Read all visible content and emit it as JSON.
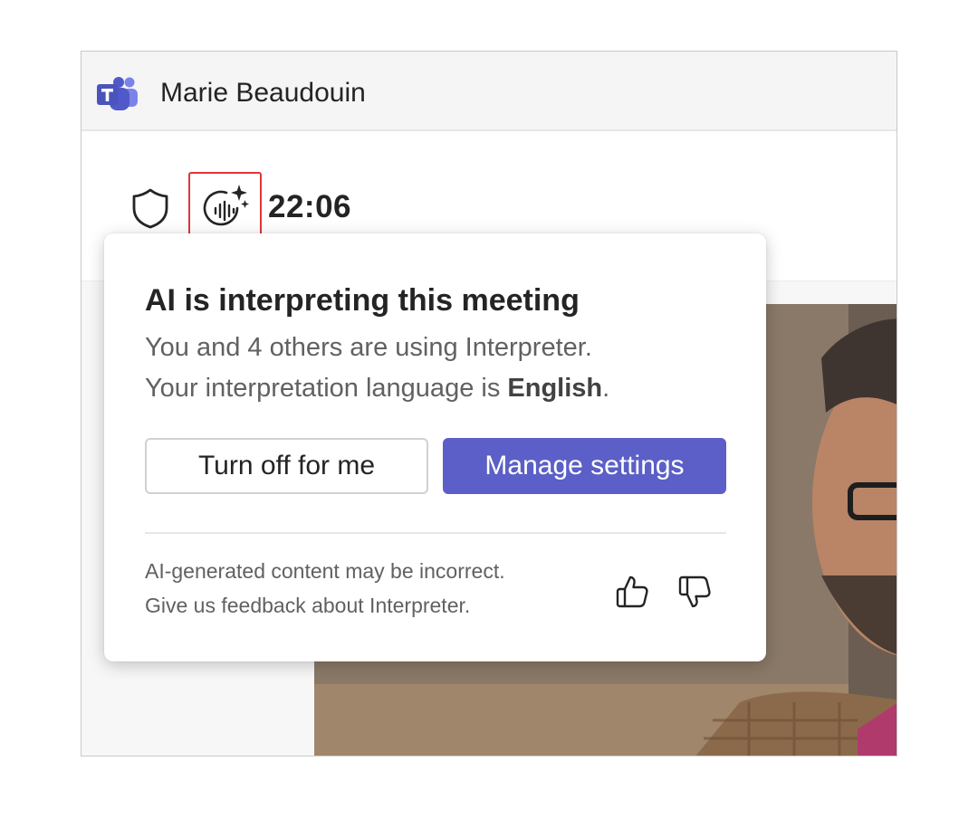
{
  "window": {
    "title": "Marie Beaudouin",
    "app_icon": "teams-logo-icon"
  },
  "toolbar": {
    "security_icon": "shield-icon",
    "interpreter_icon": "interpreter-ai-icon",
    "timer": "22:06"
  },
  "popover": {
    "title": "AI is interpreting this meeting",
    "line1": "You and 4 others are using Interpreter.",
    "line2_prefix": "Your interpretation language is ",
    "line2_language": "English",
    "line2_suffix": ".",
    "turn_off_label": "Turn off for me",
    "manage_label": "Manage settings",
    "disclaimer": "AI-generated content may be incorrect.",
    "feedback": "Give us feedback about Interpreter.",
    "like_icon": "thumbs-up-icon",
    "dislike_icon": "thumbs-down-icon"
  },
  "colors": {
    "accent": "#5b5fc7",
    "highlight": "#e0353b"
  }
}
